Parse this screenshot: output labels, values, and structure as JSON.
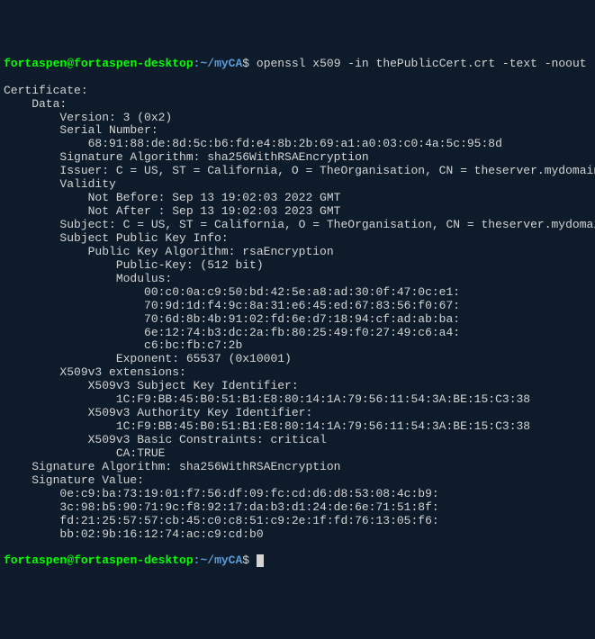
{
  "prompt": {
    "user": "fortaspen",
    "separator_at": "@",
    "host": "fortaspen-desktop",
    "colon": ":",
    "path": "~/myCA",
    "dollar": "$ "
  },
  "command": "openssl x509 -in thePublicCert.crt -text -noout",
  "output": {
    "lines": [
      "Certificate:",
      "    Data:",
      "        Version: 3 (0x2)",
      "        Serial Number:",
      "            68:91:88:de:8d:5c:b6:fd:e4:8b:2b:69:a1:a0:03:c0:4a:5c:95:8d",
      "        Signature Algorithm: sha256WithRSAEncryption",
      "        Issuer: C = US, ST = California, O = TheOrganisation, CN = theserver.mydomain.net",
      "        Validity",
      "            Not Before: Sep 13 19:02:03 2022 GMT",
      "            Not After : Sep 13 19:02:03 2023 GMT",
      "        Subject: C = US, ST = California, O = TheOrganisation, CN = theserver.mydomain.net",
      "        Subject Public Key Info:",
      "            Public Key Algorithm: rsaEncryption",
      "                Public-Key: (512 bit)",
      "                Modulus:",
      "                    00:c0:0a:c9:50:bd:42:5e:a8:ad:30:0f:47:0c:e1:",
      "                    70:9d:1d:f4:9c:8a:31:e6:45:ed:67:83:56:f0:67:",
      "                    70:6d:8b:4b:91:02:fd:6e:d7:18:94:cf:ad:ab:ba:",
      "                    6e:12:74:b3:dc:2a:fb:80:25:49:f0:27:49:c6:a4:",
      "                    c6:bc:fb:c7:2b",
      "                Exponent: 65537 (0x10001)",
      "        X509v3 extensions:",
      "            X509v3 Subject Key Identifier: ",
      "                1C:F9:BB:45:B0:51:B1:E8:80:14:1A:79:56:11:54:3A:BE:15:C3:38",
      "            X509v3 Authority Key Identifier: ",
      "                1C:F9:BB:45:B0:51:B1:E8:80:14:1A:79:56:11:54:3A:BE:15:C3:38",
      "            X509v3 Basic Constraints: critical",
      "                CA:TRUE",
      "    Signature Algorithm: sha256WithRSAEncryption",
      "    Signature Value:",
      "        0e:c9:ba:73:19:01:f7:56:df:09:fc:cd:d6:d8:53:08:4c:b9:",
      "        3c:98:b5:90:71:9c:f8:92:17:da:b3:d1:24:de:6e:71:51:8f:",
      "        fd:21:25:57:57:cb:45:c0:c8:51:c9:2e:1f:fd:76:13:05:f6:",
      "        bb:02:9b:16:12:74:ac:c9:cd:b0"
    ]
  }
}
